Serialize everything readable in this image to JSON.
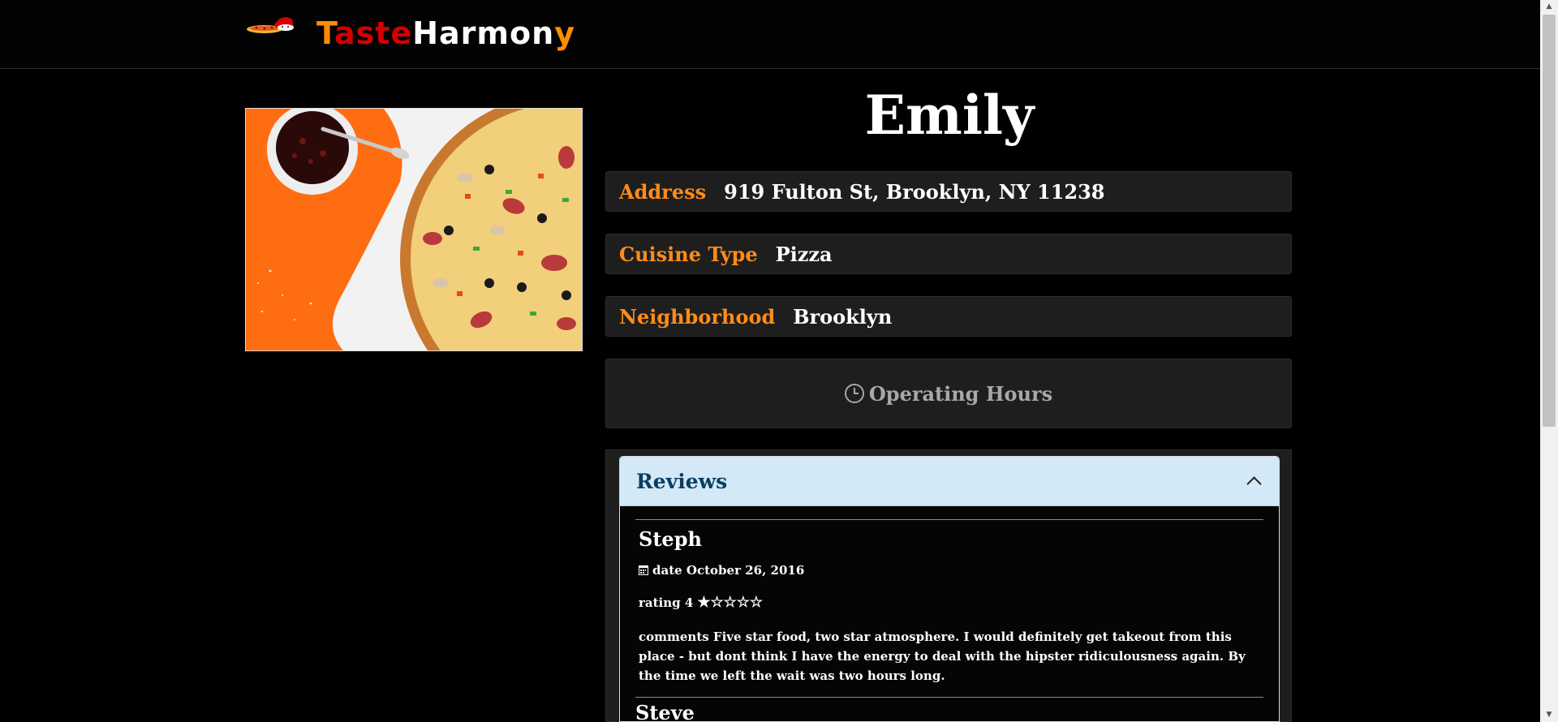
{
  "brand": {
    "parts": [
      "T",
      "aste",
      "Harmon",
      "y"
    ],
    "colors": {
      "orange": "#ff8c00",
      "red": "#d40000",
      "white": "#ffffff"
    },
    "logo_icon": "pizza-chef-icon"
  },
  "restaurant": {
    "name": "Emily",
    "image_icon": "pizza-photo",
    "address_label": "Address",
    "address": "919 Fulton St, Brooklyn, NY 11238",
    "cuisine_label": "Cuisine Type",
    "cuisine": "Pizza",
    "neighborhood_label": "Neighborhood",
    "neighborhood": "Brooklyn",
    "hours_label": "Operating Hours",
    "hours_icon": "clock-icon"
  },
  "reviews": {
    "title": "Reviews",
    "toggle_icon": "chevron-up-icon",
    "items": [
      {
        "name": "Steph",
        "date_label": "date October 26, 2016",
        "rating_label": "rating 4",
        "stars": "★☆☆☆☆",
        "comments": "comments Five star food, two star atmosphere. I would definitely get takeout from this place - but dont think I have the energy to deal with the hipster ridiculousness again. By the time we left the wait was two hours long."
      }
    ],
    "next_partial": "Steve"
  },
  "accent_color": "#ff8c1a",
  "reviews_header_color": "#d3e9f7"
}
